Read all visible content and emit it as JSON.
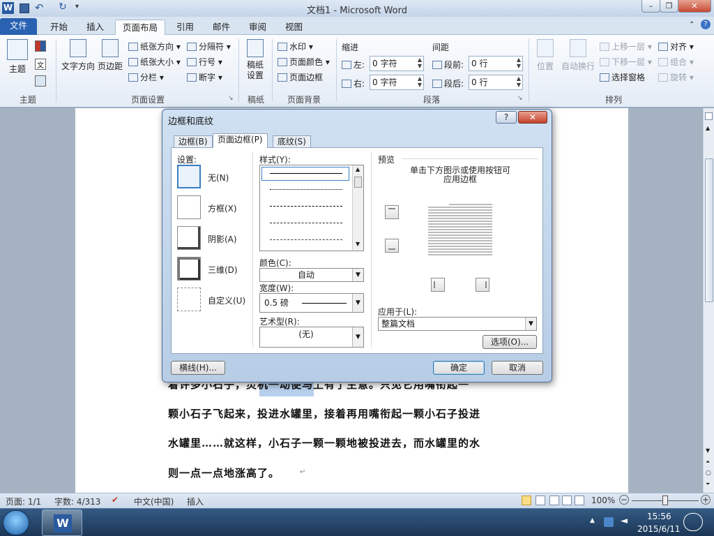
{
  "window": {
    "title": "文档1 - Microsoft Word",
    "app_icon": "W"
  },
  "quick_access": {
    "undo": "↶",
    "redo": "↻"
  },
  "ribbon_tabs": [
    "文件",
    "开始",
    "插入",
    "页面布局",
    "引用",
    "邮件",
    "审阅",
    "视图"
  ],
  "ribbon": {
    "groups": {
      "theme": "主题",
      "page_setup": "页面设置",
      "manuscript": "稿纸",
      "page_background": "页面背景",
      "paragraph": "段落",
      "arrange": "排列"
    },
    "theme_btn": "主题",
    "text_direction": "文字方向",
    "margins": "页边距",
    "orientation": "纸张方向",
    "size": "纸张大小",
    "columns": "分栏",
    "breaks": "分隔符",
    "line_numbers": "行号",
    "hyphenation": "断字",
    "manuscript_setup": "稿纸\n设置",
    "watermark": "水印",
    "page_color": "页面颜色",
    "page_borders": "页面边框",
    "indent": {
      "label": "缩进",
      "left": "左:",
      "left_value": "0 字符",
      "right": "右:",
      "right_value": "0 字符"
    },
    "spacing": {
      "label": "间距",
      "before": "段前:",
      "before_value": "0 行",
      "after": "段后:",
      "after_value": "0 行"
    },
    "position": "位置",
    "wrap": "自动换行",
    "bring_forward": "上移一层",
    "send_backward": "下移一层",
    "selection_pane": "选择窗格",
    "align": "对齐",
    "group": "组合",
    "rotate": "旋转"
  },
  "document": {
    "lines": [
      "着许多小石子，灵机一动便马上有了主意。只见它用嘴衔起一",
      "颗小石子飞起来，投进水罐里，接着再用嘴衔起一颗小石子投进",
      "水罐里……就这样，小石子一颗一颗地被投进去，而水罐里的水",
      "则一点一点地涨高了。"
    ]
  },
  "dialog": {
    "title": "边框和底纹",
    "help": "?",
    "close": "✕",
    "tabs": [
      "边框(B)",
      "页面边框(P)",
      "底纹(S)"
    ],
    "settings_label": "设置:",
    "settings": [
      "无(N)",
      "方框(X)",
      "阴影(A)",
      "三维(D)",
      "自定义(U)"
    ],
    "style_label": "样式(Y):",
    "color_label": "颜色(C):",
    "color_value": "自动",
    "width_label": "宽度(W):",
    "width_value": "0.5 磅",
    "art_label": "艺术型(R):",
    "art_value": "(无)",
    "preview_label": "预览",
    "preview_hint": "单击下方图示或使用按钮可\n应用边框",
    "apply_label": "应用于(L):",
    "apply_value": "整篇文档",
    "options_btn": "选项(O)...",
    "hline_btn": "横线(H)...",
    "ok_btn": "确定",
    "cancel_btn": "取消"
  },
  "status": {
    "page": "页面: 1/1",
    "words": "字数: 4/313",
    "language": "中文(中国)",
    "mode": "插入",
    "zoom": "100%"
  },
  "taskbar": {
    "time": "15:56",
    "date": "2015/6/11"
  }
}
